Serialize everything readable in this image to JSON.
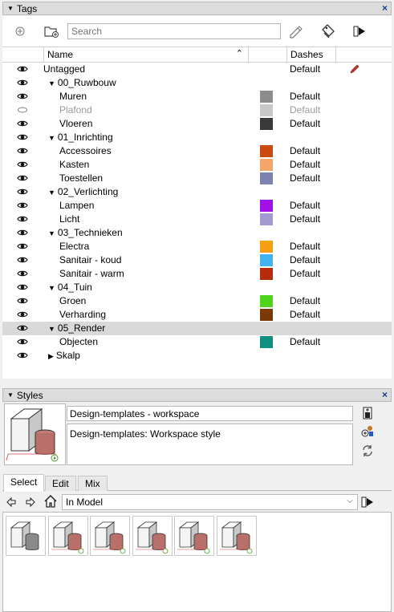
{
  "tags_panel": {
    "title": "Tags",
    "search_placeholder": "Search",
    "columns": {
      "name": "Name",
      "dashes": "Dashes"
    },
    "rows": [
      {
        "name": "Untagged",
        "dashes": "Default",
        "indent": 0,
        "expander": "",
        "visible": true,
        "color": "",
        "pencil": true
      },
      {
        "name": "00_Ruwbouw",
        "dashes": "",
        "indent": 1,
        "expander": "▼",
        "visible": true,
        "color": ""
      },
      {
        "name": "Muren",
        "dashes": "Default",
        "indent": 2,
        "expander": "",
        "visible": true,
        "color": "#8c8c8c"
      },
      {
        "name": "Plafond",
        "dashes": "Default",
        "indent": 2,
        "expander": "",
        "visible": false,
        "color": "#c8c8c8"
      },
      {
        "name": "Vloeren",
        "dashes": "Default",
        "indent": 2,
        "expander": "",
        "visible": true,
        "color": "#3a3a3a"
      },
      {
        "name": "01_Inrichting",
        "dashes": "",
        "indent": 1,
        "expander": "▼",
        "visible": true,
        "color": ""
      },
      {
        "name": "Accessoires",
        "dashes": "Default",
        "indent": 2,
        "expander": "",
        "visible": true,
        "color": "#cc4a10"
      },
      {
        "name": "Kasten",
        "dashes": "Default",
        "indent": 2,
        "expander": "",
        "visible": true,
        "color": "#f5a46a"
      },
      {
        "name": "Toestellen",
        "dashes": "Default",
        "indent": 2,
        "expander": "",
        "visible": true,
        "color": "#7d83ad"
      },
      {
        "name": "02_Verlichting",
        "dashes": "",
        "indent": 1,
        "expander": "▼",
        "visible": true,
        "color": ""
      },
      {
        "name": "Lampen",
        "dashes": "Default",
        "indent": 2,
        "expander": "",
        "visible": true,
        "color": "#a010e8"
      },
      {
        "name": "Licht",
        "dashes": "Default",
        "indent": 2,
        "expander": "",
        "visible": true,
        "color": "#a49ad0"
      },
      {
        "name": "03_Technieken",
        "dashes": "",
        "indent": 1,
        "expander": "▼",
        "visible": true,
        "color": ""
      },
      {
        "name": "Electra",
        "dashes": "Default",
        "indent": 2,
        "expander": "",
        "visible": true,
        "color": "#f5a010"
      },
      {
        "name": "Sanitair - koud",
        "dashes": "Default",
        "indent": 2,
        "expander": "",
        "visible": true,
        "color": "#40b4f0"
      },
      {
        "name": "Sanitair - warm",
        "dashes": "Default",
        "indent": 2,
        "expander": "",
        "visible": true,
        "color": "#b82a0c"
      },
      {
        "name": "04_Tuin",
        "dashes": "",
        "indent": 1,
        "expander": "▼",
        "visible": true,
        "color": ""
      },
      {
        "name": "Groen",
        "dashes": "Default",
        "indent": 2,
        "expander": "",
        "visible": true,
        "color": "#4ed41a"
      },
      {
        "name": "Verharding",
        "dashes": "Default",
        "indent": 2,
        "expander": "",
        "visible": true,
        "color": "#7a3a08"
      },
      {
        "name": "05_Render",
        "dashes": "",
        "indent": 1,
        "expander": "▼",
        "visible": true,
        "color": "",
        "selected": true
      },
      {
        "name": "Objecten",
        "dashes": "Default",
        "indent": 2,
        "expander": "",
        "visible": true,
        "color": "#109080"
      },
      {
        "name": "Skalp",
        "dashes": "",
        "indent": 1,
        "expander": "▶",
        "visible": true,
        "color": ""
      }
    ]
  },
  "styles_panel": {
    "title": "Styles",
    "style_name": "Design-templates - workspace",
    "style_description": "Design-templates:  Workspace style",
    "tabs": [
      "Select",
      "Edit",
      "Mix"
    ],
    "active_tab": "Select",
    "collection": "In Model",
    "thumbnail_count": 6
  },
  "colors": {
    "pencil": "#c0392b",
    "close": "#1a3a8a"
  },
  "icons": [
    "add-tag-icon",
    "add-folder-icon",
    "eraser-icon",
    "tag-color-icon",
    "details-arrow-icon",
    "eye-icon",
    "pencil-icon",
    "create-style-icon",
    "update-style-icon",
    "back-icon",
    "forward-icon",
    "home-icon"
  ]
}
